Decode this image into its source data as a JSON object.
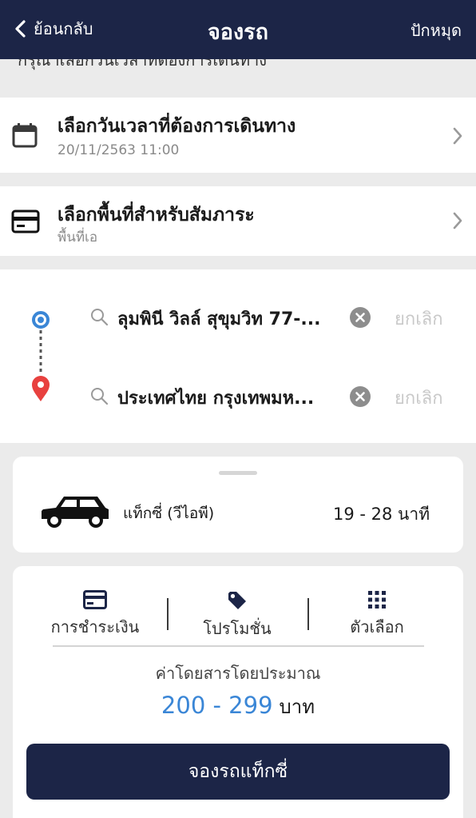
{
  "nav": {
    "back_label": "ย้อนกลับ",
    "title": "จองรถ",
    "pin_label": "ปักหมุด"
  },
  "hint": "กรุณาเลือกวันเวลาที่ต้องการเดินทาง",
  "datetime": {
    "title": "เลือกวันเวลาที่ต้องการเดินทาง",
    "value": "20/11/2563 11:00"
  },
  "luggage": {
    "title": "เลือกพื้นที่สำหรับสัมภาระ",
    "value": "พื้นที่เอ"
  },
  "route": {
    "origin": "ลุมพินี วิลล์ สุขุมวิท 77-...",
    "destination": "ประเทศไทย กรุงเทพมห...",
    "cancel_label": "ยกเลิก"
  },
  "vehicle": {
    "name": "แท็กซี่ (วีไอพี)",
    "eta": "19 - 28  นาที"
  },
  "options": {
    "payment": "การชำระเงิน",
    "promotion": "โปรโมชั่น",
    "more": "ตัวเลือก"
  },
  "fare": {
    "label": "ค่าโดยสารโดยประมาณ",
    "range": "200 - 299",
    "unit": "บาท"
  },
  "book_button": "จองรถแท็กซี่",
  "colors": {
    "navy": "#1c2547",
    "accent_blue": "#3a86d6",
    "origin_marker": "#3a86d6",
    "destination_marker": "#e8413f"
  }
}
